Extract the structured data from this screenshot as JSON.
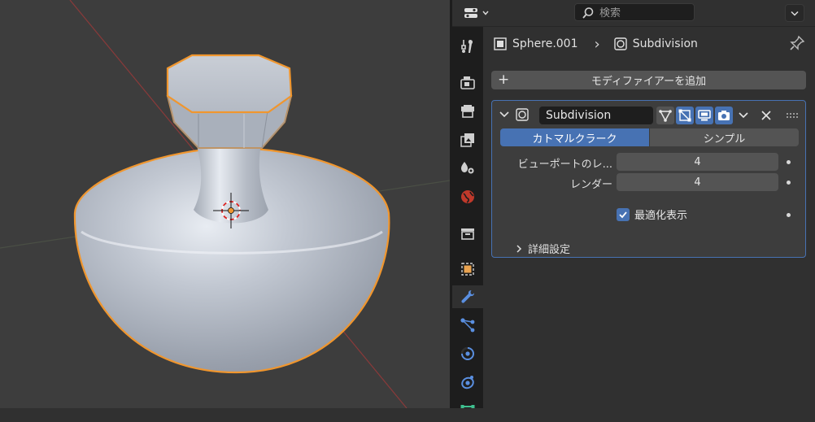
{
  "header": {
    "search_placeholder": "検索"
  },
  "tabs": [
    {
      "name": "tool-tab",
      "icon": "tool-icon"
    },
    {
      "name": "render-tab",
      "icon": "render-icon"
    },
    {
      "name": "output-tab",
      "icon": "output-icon"
    },
    {
      "name": "view-layer-tab",
      "icon": "view-layer-icon"
    },
    {
      "name": "scene-tab",
      "icon": "scene-icon"
    },
    {
      "name": "world-tab",
      "icon": "world-icon"
    },
    {
      "name": "collection-tab",
      "icon": "collection-icon"
    },
    {
      "name": "object-tab",
      "icon": "object-icon"
    },
    {
      "name": "modifier-tab",
      "icon": "wrench-icon",
      "active": true
    },
    {
      "name": "particles-tab",
      "icon": "particles-icon"
    },
    {
      "name": "physics-tab",
      "icon": "physics-icon"
    },
    {
      "name": "constraints-tab",
      "icon": "constraints-icon"
    },
    {
      "name": "data-tab",
      "icon": "data-icon"
    }
  ],
  "breadcrumb": {
    "object": "Sphere.001",
    "separator": "›",
    "modifier": "Subdivision"
  },
  "add_modifier_label": "モディファイアーを追加",
  "modifier": {
    "name": "Subdivision",
    "algorithms": [
      "カトマルクラーク",
      "シンプル"
    ],
    "selected_algorithm": "カトマルクラーク",
    "levels_viewport_label": "ビューポートのレ...",
    "levels_viewport_value": "4",
    "render_label": "レンダー",
    "render_value": "4",
    "optimal_display_label": "最適化表示",
    "optimal_display_checked": true,
    "advanced_label": "詳細設定"
  },
  "colors": {
    "accent": "#4772b3",
    "selection_outline": "#f0962e",
    "panel_bg": "#3d3d3d",
    "field_bg": "#545454"
  }
}
